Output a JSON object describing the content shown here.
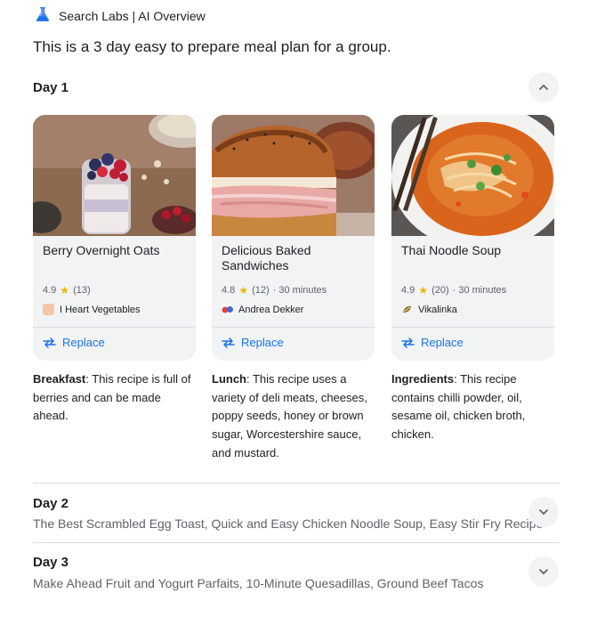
{
  "header": {
    "title": "Search Labs | AI Overview",
    "icon": "flask-icon"
  },
  "intro": "This is a 3 day easy to prepare meal plan for a group.",
  "day1": {
    "label": "Day 1",
    "cards": [
      {
        "title": "Berry Overnight Oats",
        "rating": "4.9",
        "count": "(13)",
        "time": "",
        "source": "I Heart Vegetables",
        "replace": "Replace"
      },
      {
        "title": "Delicious Baked Sandwiches",
        "rating": "4.8",
        "count": "(12)",
        "time": "· 30 minutes",
        "source": "Andrea Dekker",
        "replace": "Replace"
      },
      {
        "title": "Thai Noodle Soup",
        "rating": "4.9",
        "count": "(20)",
        "time": "· 30 minutes",
        "source": "Vikalinka",
        "replace": "Replace"
      }
    ],
    "descriptions": [
      {
        "label": "Breakfast",
        "text": ": This recipe is full of berries and can be made ahead."
      },
      {
        "label": "Lunch",
        "text": ": This recipe uses a variety of deli meats, cheeses, poppy seeds, honey or brown sugar, Worcestershire sauce, and mustard."
      },
      {
        "label": "Ingredients",
        "text": ": This recipe contains chilli powder, oil, sesame oil, chicken broth, chicken."
      }
    ]
  },
  "day2": {
    "label": "Day 2",
    "summary": "The Best Scrambled Egg Toast, Quick and Easy Chicken Noodle Soup, Easy Stir Fry Recipe"
  },
  "day3": {
    "label": "Day 3",
    "summary": "Make Ahead Fruit and Yogurt Parfaits, 10-Minute Quesadillas, Ground Beef Tacos"
  },
  "colors": {
    "accent": "#1a73e8",
    "star": "#f4b400",
    "card_bg": "#f1f3f4",
    "muted": "#5f6368"
  }
}
